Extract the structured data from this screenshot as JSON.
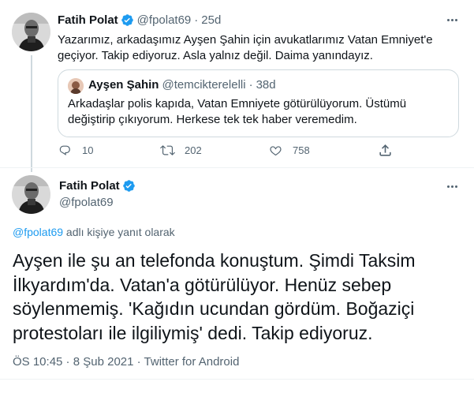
{
  "parent_tweet": {
    "author_name": "Fatih Polat",
    "author_handle": "@fpolat69",
    "separator": "·",
    "age": "25d",
    "text_line1": "Yazarımız, arkadaşımız Ayşen Şahin için avukatlarımız Vatan Emniyet'e",
    "text_line2": "geçiyor. Takip ediyoruz. Asla yalnız değil. Daima yanındayız.",
    "quote": {
      "author_name": "Ayşen Şahin",
      "author_handle": "@temcikterelelli",
      "separator": "·",
      "age": "38d",
      "text_line1": "Arkadaşlar polis kapıda, Vatan Emniyete götürülüyorum. Üstümü",
      "text_line2": "değiştirip çıkıyorum. Herkese tek tek haber veremedim."
    },
    "actions": {
      "reply_count": "10",
      "retweet_count": "202",
      "like_count": "758"
    }
  },
  "main_tweet": {
    "author_name": "Fatih Polat",
    "author_handle": "@fpolat69",
    "replying_mention": "@fpolat69",
    "replying_suffix": " adlı kişiye yanıt olarak",
    "text_line1": "Ayşen ile şu an telefonda konuştum. Şimdi Taksim",
    "text_line2": "İlkyardım'da. Vatan'a götürülüyor. Henüz sebep",
    "text_line3": "söylenmemiş. 'Kağıdın ucundan gördüm. Boğaziçi",
    "text_line4": "protestoları ile ilgiliymiş' dedi. Takip ediyoruz.",
    "time": "ÖS 10:45",
    "separator1": " · ",
    "date": "8 Şub 2021",
    "separator2": " · ",
    "source": "Twitter for Android"
  },
  "icons": {
    "verified": "verified-badge-icon",
    "more": "more-options-icon",
    "reply": "reply-icon",
    "retweet": "retweet-icon",
    "like": "like-icon",
    "share": "share-icon"
  },
  "colors": {
    "accent": "#1d9bf0",
    "text_primary": "#0f1419",
    "text_secondary": "#536471",
    "border": "#cfd9de"
  }
}
